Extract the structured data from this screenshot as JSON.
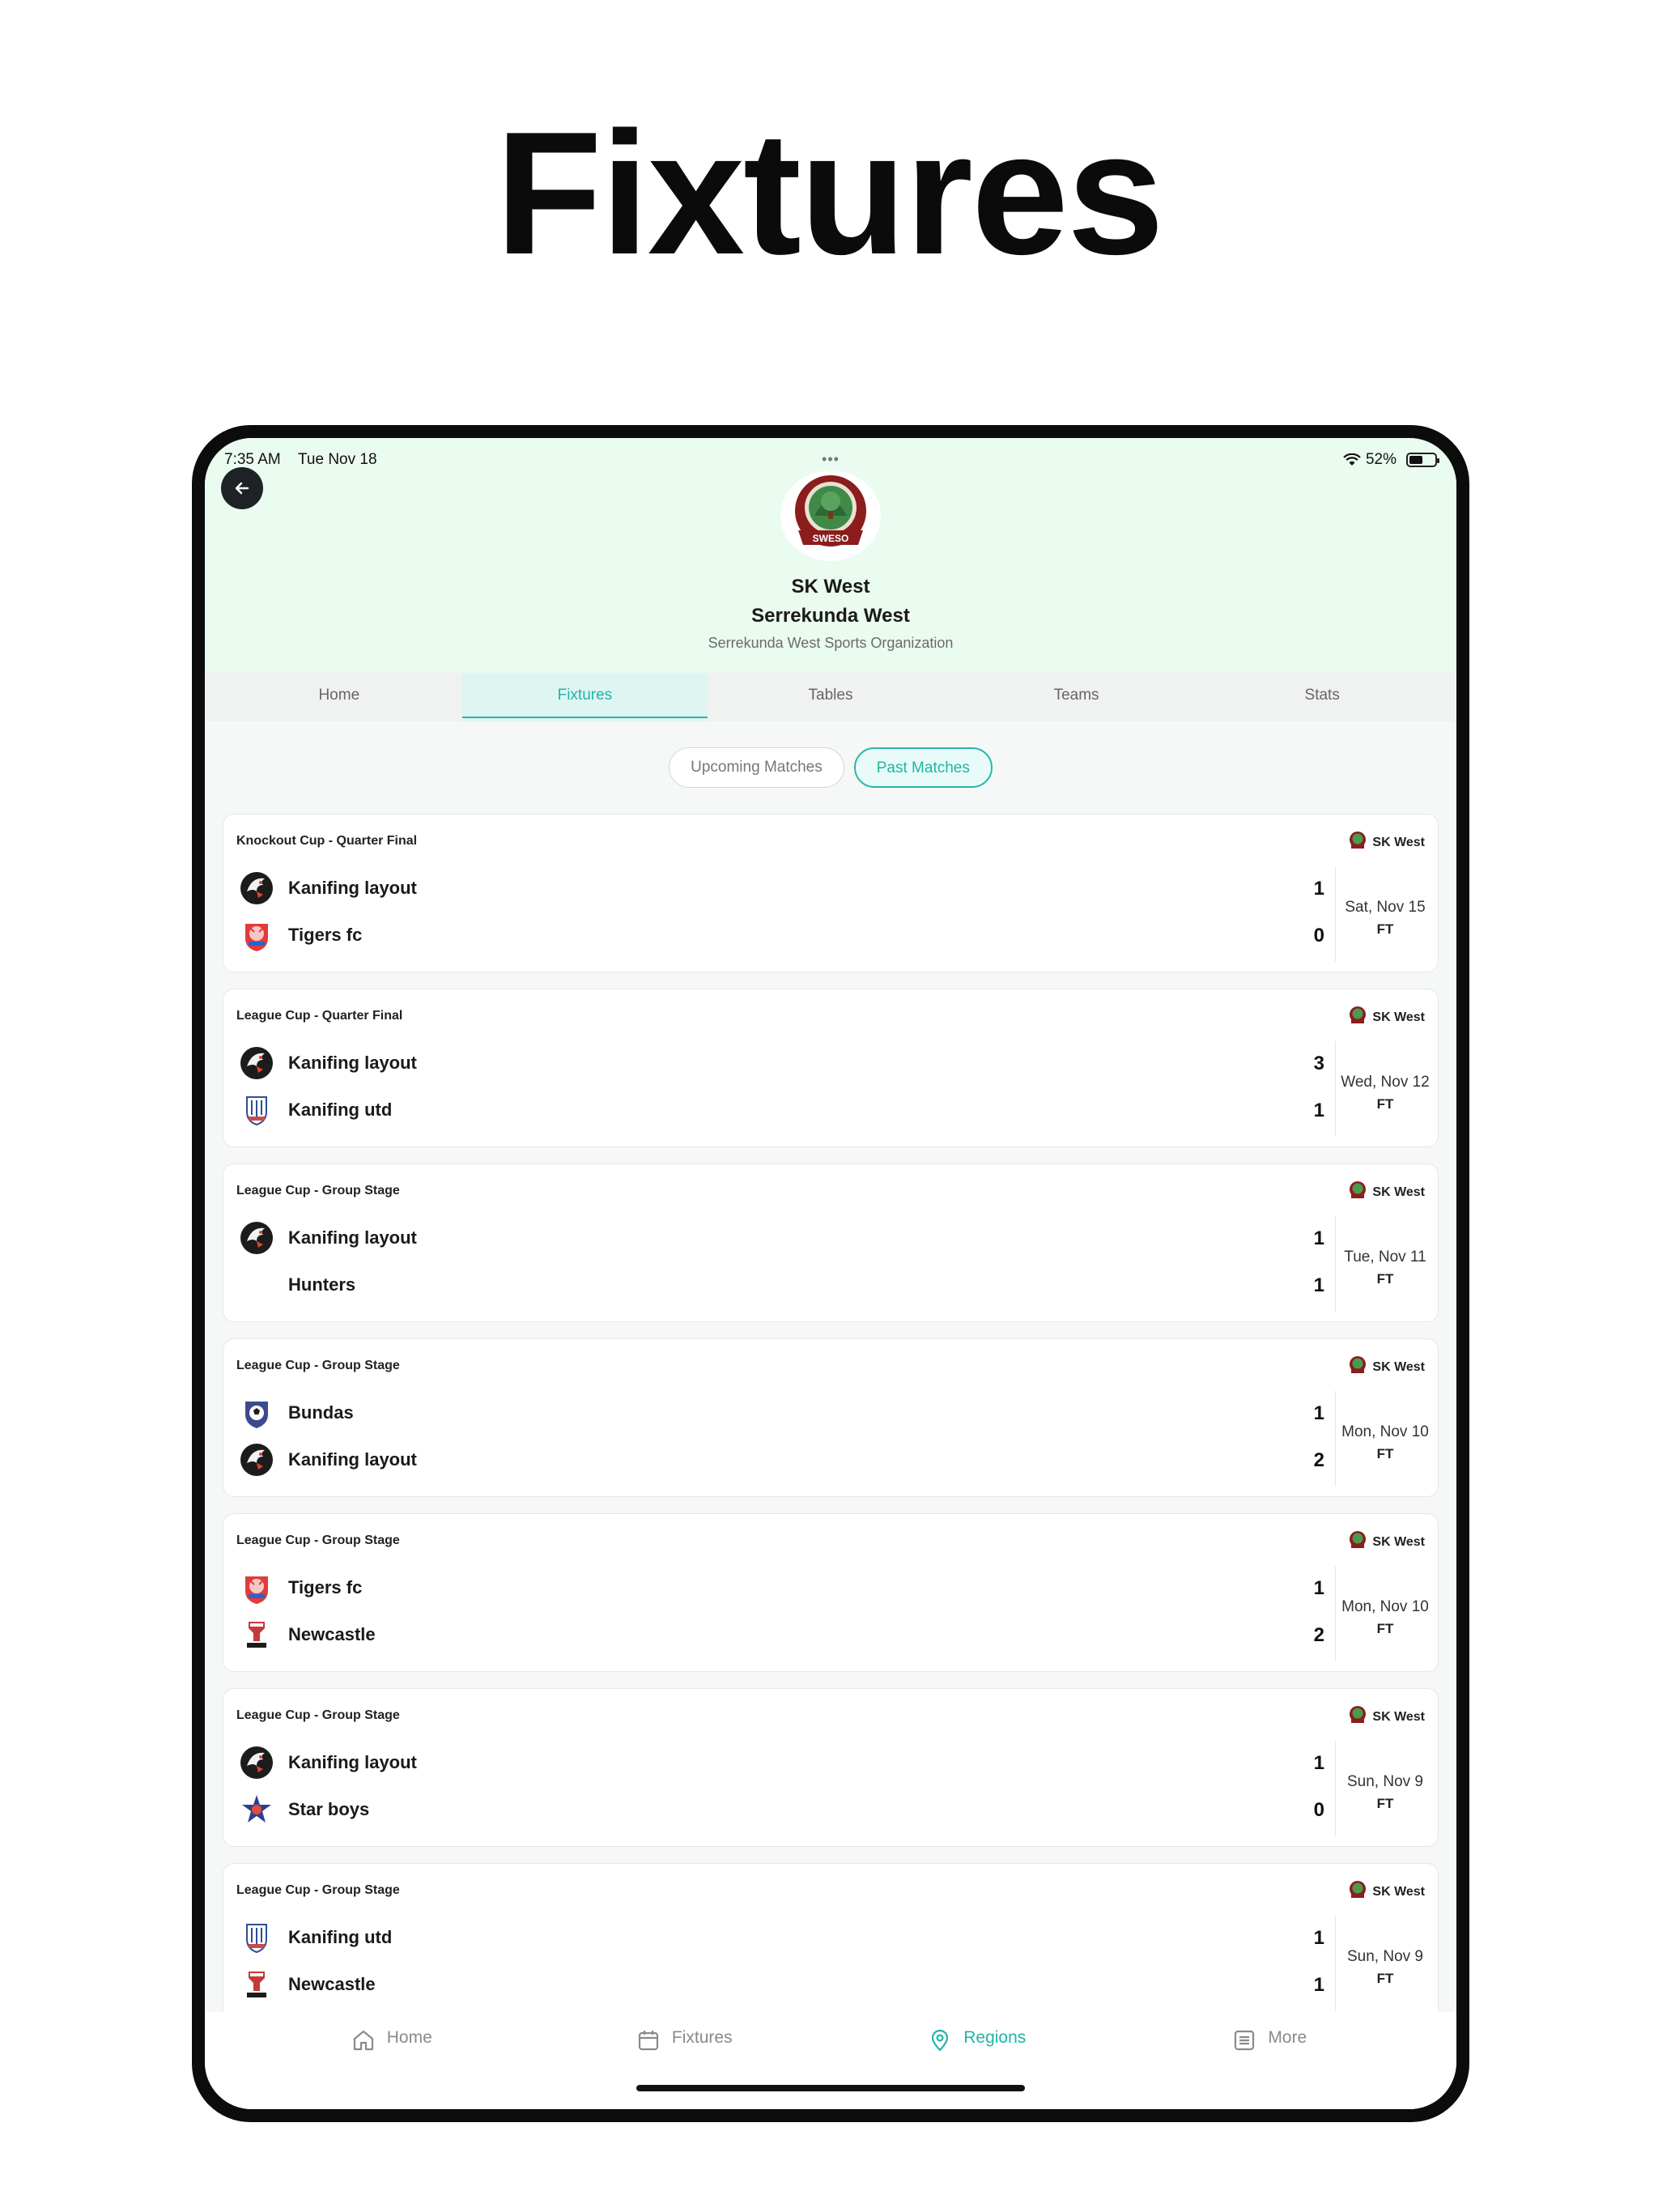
{
  "headline": "Fixtures",
  "status": {
    "time": "7:35 AM",
    "date": "Tue Nov 18",
    "battery": "52%",
    "battery_level": 0.52
  },
  "header": {
    "short_name": "SK West",
    "region_name": "Serrekunda West",
    "full_name": "Serrekunda West Sports Organization",
    "logo_text": "SWESO"
  },
  "tabs": [
    "Home",
    "Fixtures",
    "Tables",
    "Teams",
    "Stats"
  ],
  "active_tab": "Fixtures",
  "segments": {
    "upcoming": "Upcoming Matches",
    "past": "Past Matches",
    "active": "past"
  },
  "matches": [
    {
      "competition": "Knockout Cup - Quarter Final",
      "region": "SK West",
      "home": {
        "name": "Kanifing layout",
        "badge": "eagle-badge",
        "score": "1"
      },
      "away": {
        "name": "Tigers fc",
        "badge": "tiger-badge",
        "score": "0"
      },
      "date": "Sat, Nov 15",
      "status": "FT"
    },
    {
      "competition": "League Cup - Quarter Final",
      "region": "SK West",
      "home": {
        "name": "Kanifing layout",
        "badge": "eagle-badge",
        "score": "3"
      },
      "away": {
        "name": "Kanifing utd",
        "badge": "shield-badge",
        "score": "1"
      },
      "date": "Wed, Nov 12",
      "status": "FT"
    },
    {
      "competition": "League Cup - Group Stage",
      "region": "SK West",
      "home": {
        "name": "Kanifing layout",
        "badge": "eagle-badge",
        "score": "1"
      },
      "away": {
        "name": "Hunters",
        "badge": "none",
        "score": "1"
      },
      "date": "Tue, Nov 11",
      "status": "FT"
    },
    {
      "competition": "League Cup - Group Stage",
      "region": "SK West",
      "home": {
        "name": "Bundas",
        "badge": "ball-shield-badge",
        "score": "1"
      },
      "away": {
        "name": "Kanifing layout",
        "badge": "eagle-badge",
        "score": "2"
      },
      "date": "Mon, Nov 10",
      "status": "FT"
    },
    {
      "competition": "League Cup - Group Stage",
      "region": "SK West",
      "home": {
        "name": "Tigers fc",
        "badge": "tiger-badge",
        "score": "1"
      },
      "away": {
        "name": "Newcastle",
        "badge": "newcastle-badge",
        "score": "2"
      },
      "date": "Mon, Nov 10",
      "status": "FT"
    },
    {
      "competition": "League Cup - Group Stage",
      "region": "SK West",
      "home": {
        "name": "Kanifing layout",
        "badge": "eagle-badge",
        "score": "1"
      },
      "away": {
        "name": "Star boys",
        "badge": "star-badge",
        "score": "0"
      },
      "date": "Sun, Nov 9",
      "status": "FT"
    },
    {
      "competition": "League Cup - Group Stage",
      "region": "SK West",
      "home": {
        "name": "Kanifing utd",
        "badge": "shield-badge",
        "score": "1"
      },
      "away": {
        "name": "Newcastle",
        "badge": "newcastle-badge",
        "score": "1"
      },
      "date": "Sun, Nov 9",
      "status": "FT"
    }
  ],
  "bottom_nav": [
    {
      "label": "Home",
      "icon": "home-icon"
    },
    {
      "label": "Fixtures",
      "icon": "calendar-icon"
    },
    {
      "label": "Regions",
      "icon": "location-pin-icon"
    },
    {
      "label": "More",
      "icon": "list-icon"
    }
  ],
  "active_nav": "Regions",
  "colors": {
    "accent": "#1fb5a6",
    "hero_bg": "#eafbf0",
    "logo_red": "#8b1d1d",
    "logo_green": "#2f7a3a"
  }
}
